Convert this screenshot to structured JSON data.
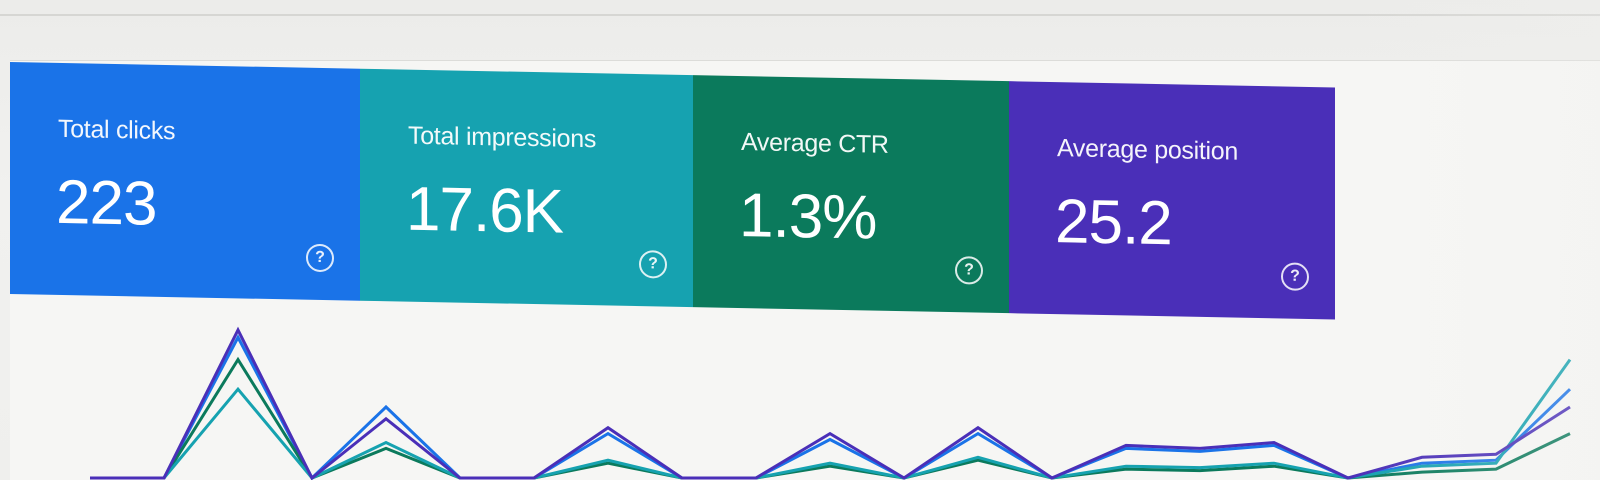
{
  "metrics": [
    {
      "label": "Total clicks",
      "value": "223",
      "color": "#1a73e8",
      "help_icon": "help-circle-icon"
    },
    {
      "label": "Total impressions",
      "value": "17.6K",
      "color": "#16a2b0",
      "help_icon": "help-circle-icon"
    },
    {
      "label": "Average CTR",
      "value": "1.3%",
      "color": "#0b7a5c",
      "help_icon": "help-circle-icon"
    },
    {
      "label": "Average position",
      "value": "25.2",
      "color": "#4a2fb8",
      "help_icon": "help-circle-icon"
    }
  ],
  "chart_data": {
    "type": "line",
    "series": [
      {
        "color": "#1a73e8",
        "values": [
          0,
          0,
          95,
          0,
          48,
          0,
          0,
          30,
          0,
          0,
          26,
          0,
          30,
          0,
          20,
          18,
          22,
          0,
          10,
          12,
          60
        ]
      },
      {
        "color": "#0b7a5c",
        "values": [
          0,
          0,
          80,
          0,
          20,
          0,
          0,
          10,
          0,
          0,
          8,
          0,
          12,
          0,
          6,
          5,
          8,
          0,
          4,
          6,
          30
        ]
      },
      {
        "color": "#16a2b0",
        "values": [
          0,
          0,
          60,
          0,
          24,
          0,
          0,
          12,
          0,
          0,
          10,
          0,
          14,
          0,
          8,
          7,
          10,
          0,
          8,
          10,
          80
        ]
      },
      {
        "color": "#4a2fb8",
        "values": [
          0,
          0,
          100,
          0,
          40,
          0,
          0,
          34,
          0,
          0,
          30,
          0,
          34,
          0,
          22,
          20,
          24,
          0,
          14,
          16,
          48
        ]
      }
    ]
  }
}
